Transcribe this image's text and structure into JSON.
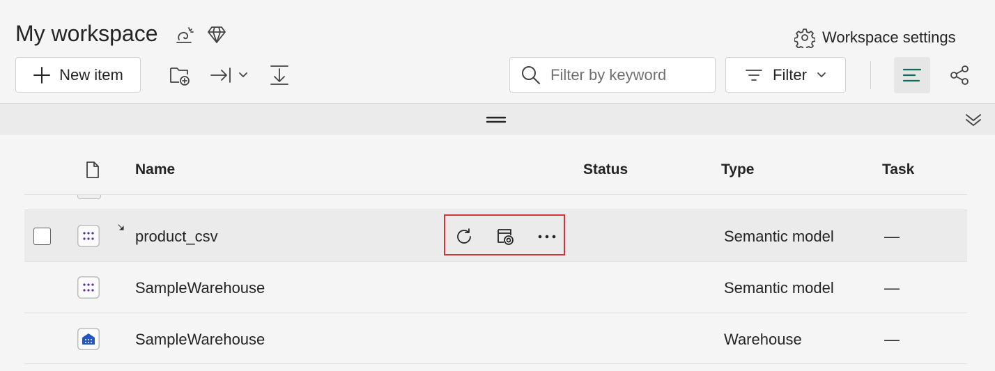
{
  "header": {
    "title": "My workspace",
    "settings_label": "Workspace settings"
  },
  "toolbar": {
    "new_item_label": "New item",
    "search_placeholder": "Filter by keyword",
    "filter_label": "Filter"
  },
  "table": {
    "columns": [
      "Name",
      "Status",
      "Type",
      "Task"
    ],
    "rows": [
      {
        "name": "product_csv",
        "status": "",
        "type": "Semantic model",
        "task": "—",
        "icon": "semantic-model-icon"
      },
      {
        "name": "SampleWarehouse",
        "status": "",
        "type": "Semantic model",
        "task": "—",
        "icon": "semantic-model-icon"
      },
      {
        "name": "SampleWarehouse",
        "status": "",
        "type": "Warehouse",
        "task": "—",
        "icon": "warehouse-icon"
      }
    ]
  },
  "row_actions": [
    "refresh-icon",
    "schedule-refresh-icon",
    "more-options-icon"
  ],
  "colors": {
    "accent": "#0f6cbd",
    "highlight_border": "#d13438",
    "semantic_icon_dots": "#5c2e91",
    "warehouse_icon": "#2358c4"
  }
}
